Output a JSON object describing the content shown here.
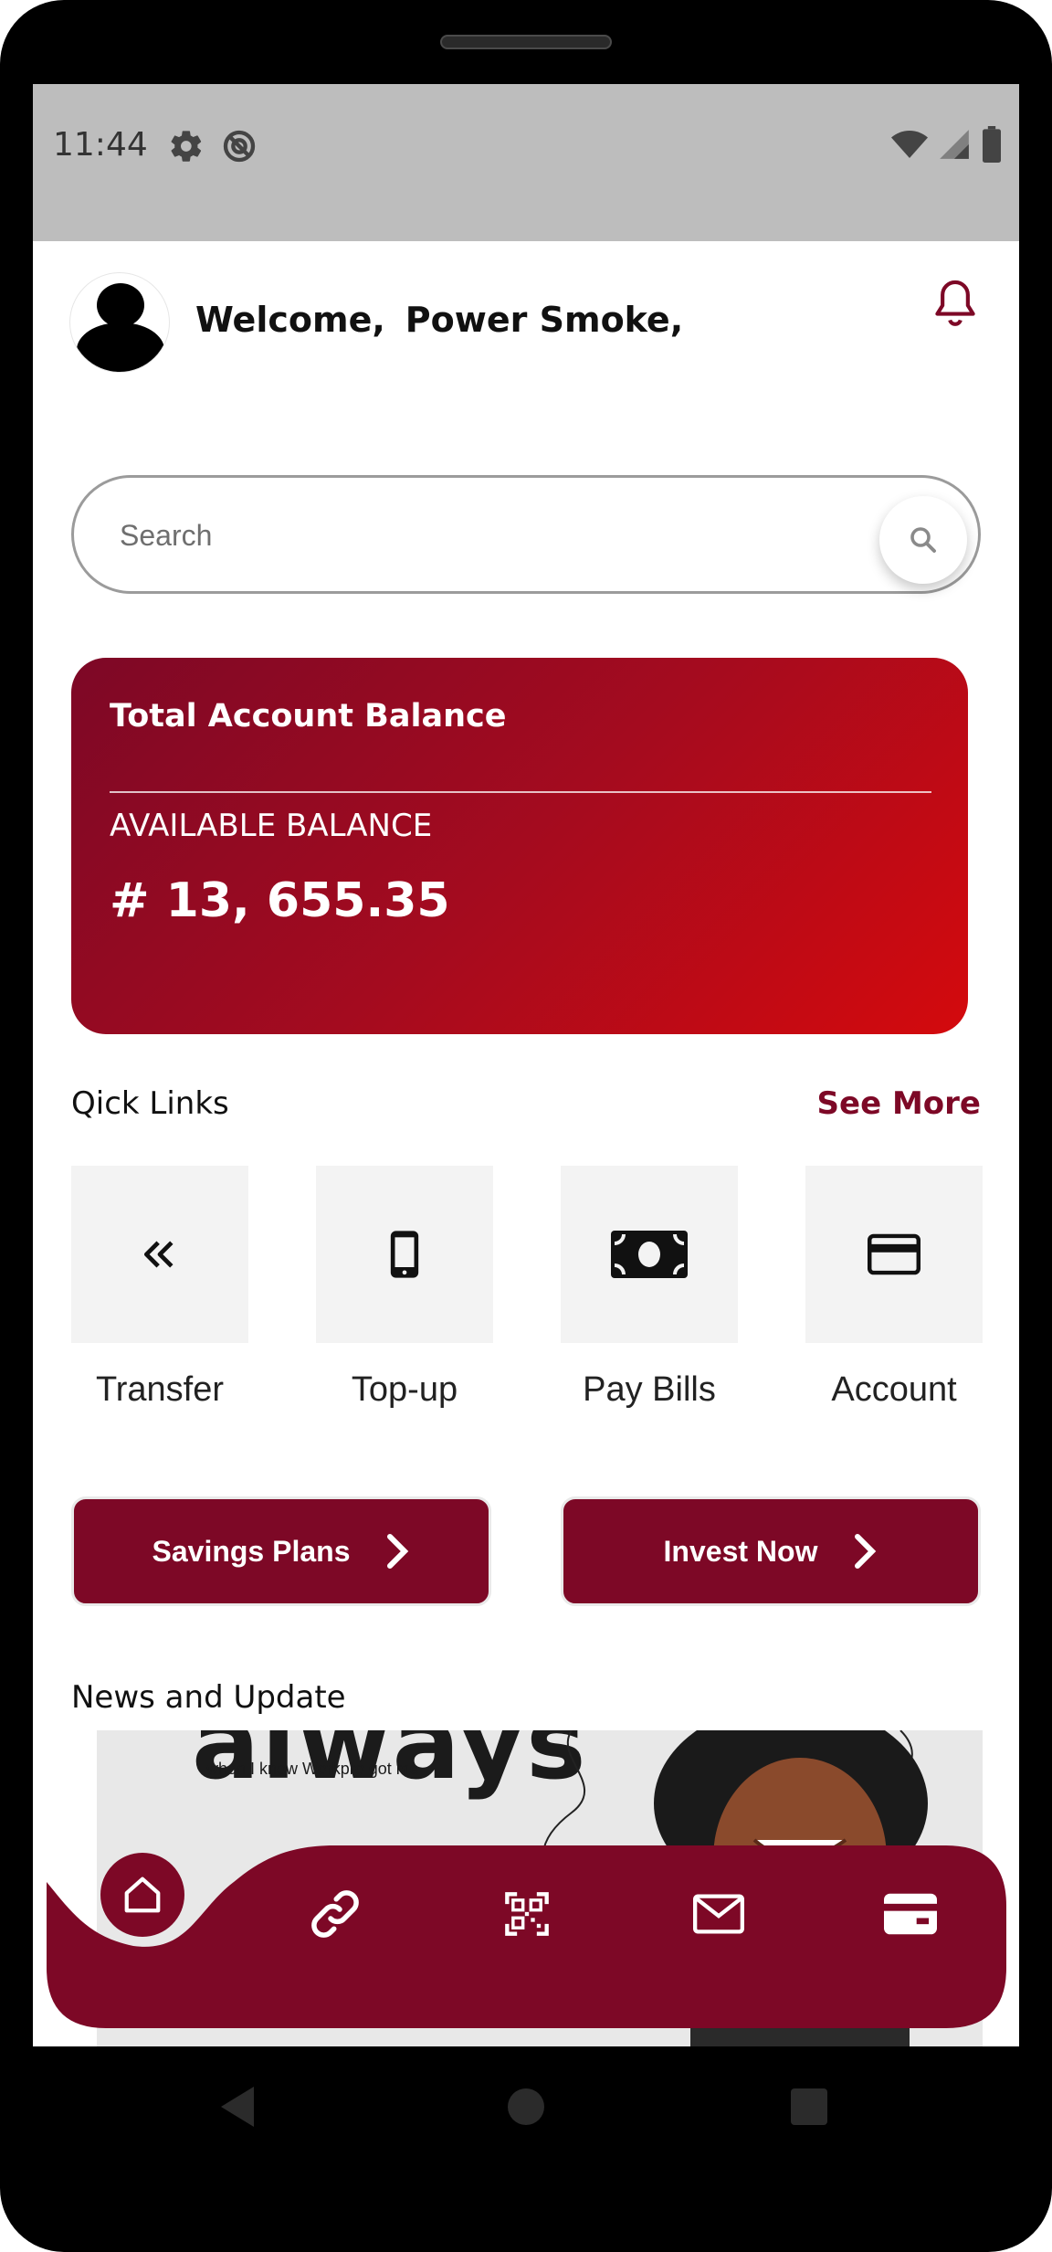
{
  "status_bar": {
    "time": "11:44",
    "icons": [
      "settings-icon",
      "do-not-disturb-icon",
      "wifi-icon",
      "signal-icon",
      "battery-icon"
    ]
  },
  "header": {
    "welcome": "Welcome,",
    "user_name": "Power Smoke,",
    "notification_icon": "bell-icon"
  },
  "search": {
    "placeholder": "Search",
    "icon": "search-icon"
  },
  "balance_card": {
    "title": "Total Account Balance",
    "subtitle": "AVAILABLE BALANCE",
    "amount": "# 13, 655.35",
    "gradient_start": "#7d0826",
    "gradient_end": "#d40a0d"
  },
  "quick_links": {
    "title": "Qick Links",
    "see_more": "See More",
    "items": [
      {
        "label": "Transfer",
        "icon": "double-chevron-left-icon"
      },
      {
        "label": "Top-up",
        "icon": "phone-icon"
      },
      {
        "label": "Pay Bills",
        "icon": "cash-icon"
      },
      {
        "label": "Account",
        "icon": "card-icon"
      }
    ]
  },
  "actions": {
    "savings": "Savings Plans",
    "invest": "Invest Now"
  },
  "news": {
    "title": "News and Update",
    "banner_big_text": "always",
    "banner_small_text": "when I know Workpro got me"
  },
  "bottom_nav": {
    "items": [
      "home-icon",
      "link-icon",
      "qr-code-icon",
      "mail-icon",
      "wallet-icon"
    ]
  },
  "colors": {
    "brand": "#7d0826",
    "background": "#ffffff",
    "status_bar": "#bdbdbd"
  }
}
